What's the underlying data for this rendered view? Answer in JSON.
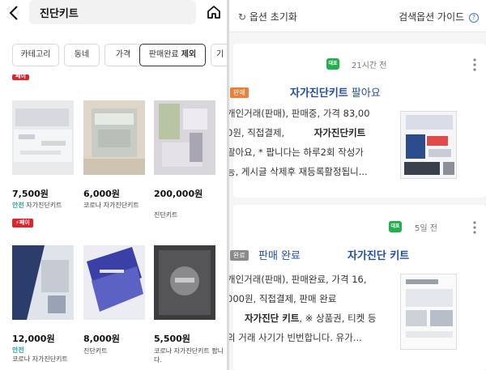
{
  "left": {
    "search_query": "진단키트",
    "filters": [
      {
        "label": "카테고리"
      },
      {
        "label": "동네"
      },
      {
        "label": "가격"
      },
      {
        "label_main": "판매완료",
        "label_bold": "제외"
      },
      {
        "label": "기"
      }
    ],
    "pay_badge": "페이",
    "products": [
      {
        "price": "7,500원",
        "safe": "안전",
        "name": "자가진단키트"
      },
      {
        "price": "6,000원",
        "safe": "",
        "name": "코로나 자가진단키트"
      },
      {
        "price": "200,000원",
        "safe": "",
        "name": "진단키트"
      },
      {
        "price": "12,000원",
        "safe": "안전",
        "name": "코로나 자가진단키트"
      },
      {
        "price": "8,000원",
        "safe": "",
        "name": "진단키트"
      },
      {
        "price": "5,500원",
        "safe": "",
        "name": "코로나 자가진단키트 팝니다."
      }
    ]
  },
  "right": {
    "reset_label": "옵션 초기화",
    "guide_label": "검색옵션 가이드",
    "guide_icon": "?",
    "cards": [
      {
        "badge": "대표",
        "ago": "21시간 전",
        "tag": "판매",
        "tag_color": "#e8823a",
        "title_bold": "자가진단키트",
        "title_rest": " 팔아요",
        "desc_lines": [
          "개인거래(판매), 판매중, 가격 83,00",
          "0원, 직접결제,",
          "팔아요, * 팝니다는 하루2회 작성가",
          "능, 게시글 삭제후 재등록활정됩니..."
        ],
        "desc_inline_bold": "자가진단키트"
      },
      {
        "badge": "대표",
        "ago": "5일 전",
        "tag": "완료",
        "tag_color": "#8a8a8a",
        "title_rest": "판매 완료",
        "title_bold": "자가진단 키트",
        "desc_lines": [
          "개인거래(판매), 판매완료, 가격 16,",
          "000원, 직접결제, 판매 완료",
          ", ※ 상품권, 티켓 등",
          "의 거래 사기가 빈번합니다. 유가..."
        ],
        "desc_inline_bold": "자가진단 키트"
      }
    ]
  }
}
